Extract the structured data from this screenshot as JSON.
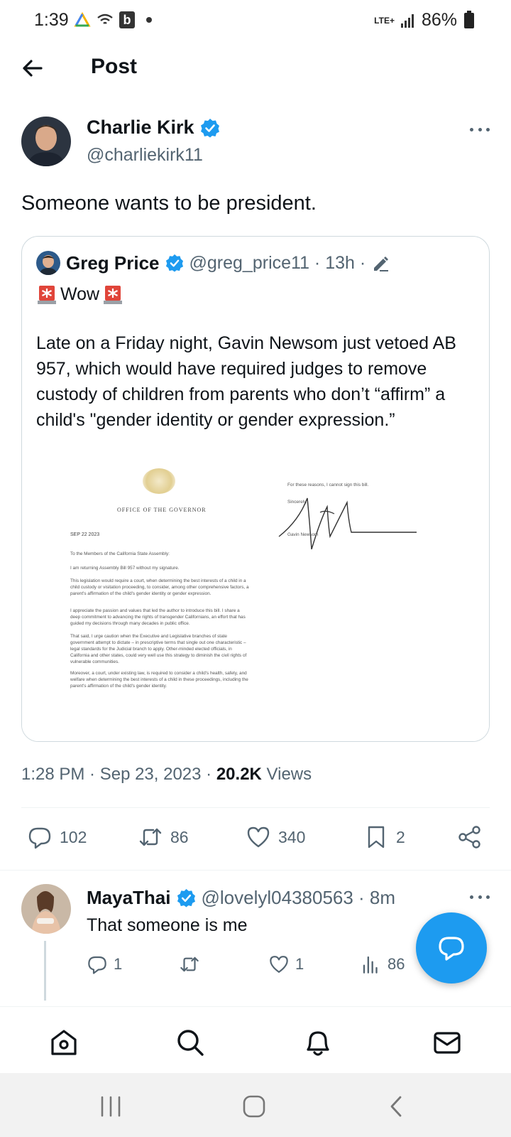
{
  "status_bar": {
    "time": "1:39",
    "network": "LTE+",
    "battery": "86%"
  },
  "header": {
    "title": "Post"
  },
  "post": {
    "author_name": "Charlie Kirk",
    "author_handle": "@charliekirk11",
    "text": "Someone wants to be president.",
    "timestamp": "1:28 PM · Sep 23, 2023 · ",
    "views_count": "20.2K",
    "views_label": " Views",
    "stats": {
      "replies": "102",
      "reposts": "86",
      "likes": "340",
      "bookmarks": "2"
    }
  },
  "quote": {
    "author_name": "Greg Price",
    "author_handle": "@greg_price11 · 13h ·",
    "wow": "Wow",
    "body": "Late on a Friday night, Gavin Newsom just vetoed AB 957, which would have required judges to remove custody of children from parents who don’t “affirm” a child's \"gender identity or gender expression.”",
    "document": {
      "office": "OFFICE OF THE GOVERNOR",
      "date": "SEP 22 2023",
      "salutation": "To the Members of the California State Assembly:",
      "p1": "I am returning Assembly Bill 957 without my signature.",
      "p2": "This legislation would require a court, when determining the best interests of a child in a child custody or visitation proceeding, to consider, among other comprehensive factors, a parent's affirmation of the child's gender identity or gender expression.",
      "p3": "I appreciate the passion and values that led the author to introduce this bill. I share a deep commitment to advancing the rights of transgender Californians, an effort that has guided my decisions through many decades in public office.",
      "p4": "That said, I urge caution when the Executive and Legislative branches of state government attempt to dictate – in prescriptive terms that single out one characteristic – legal standards for the Judicial branch to apply. Other-minded elected officials, in California and other states, could very well use this strategy to diminish the civil rights of vulnerable communities.",
      "p5": "Moreover, a court, under existing law, is required to consider a child's health, safety, and welfare when determining the best interests of a child in these proceedings, including the parent's affirmation of the child's gender identity.",
      "reasons": "For these reasons, I cannot sign this bill.",
      "sincerely": "Sincerely,",
      "signer": "Gavin Newsom"
    }
  },
  "reply": {
    "author_name": "MayaThai",
    "meta": "@lovelyl04380563 · 8m",
    "text": "That someone is me",
    "stats": {
      "replies": "1",
      "likes": "1",
      "views": "86"
    }
  },
  "colors": {
    "accent": "#1d9bf0",
    "secondary_text": "#536471",
    "border": "#cfd9de"
  }
}
